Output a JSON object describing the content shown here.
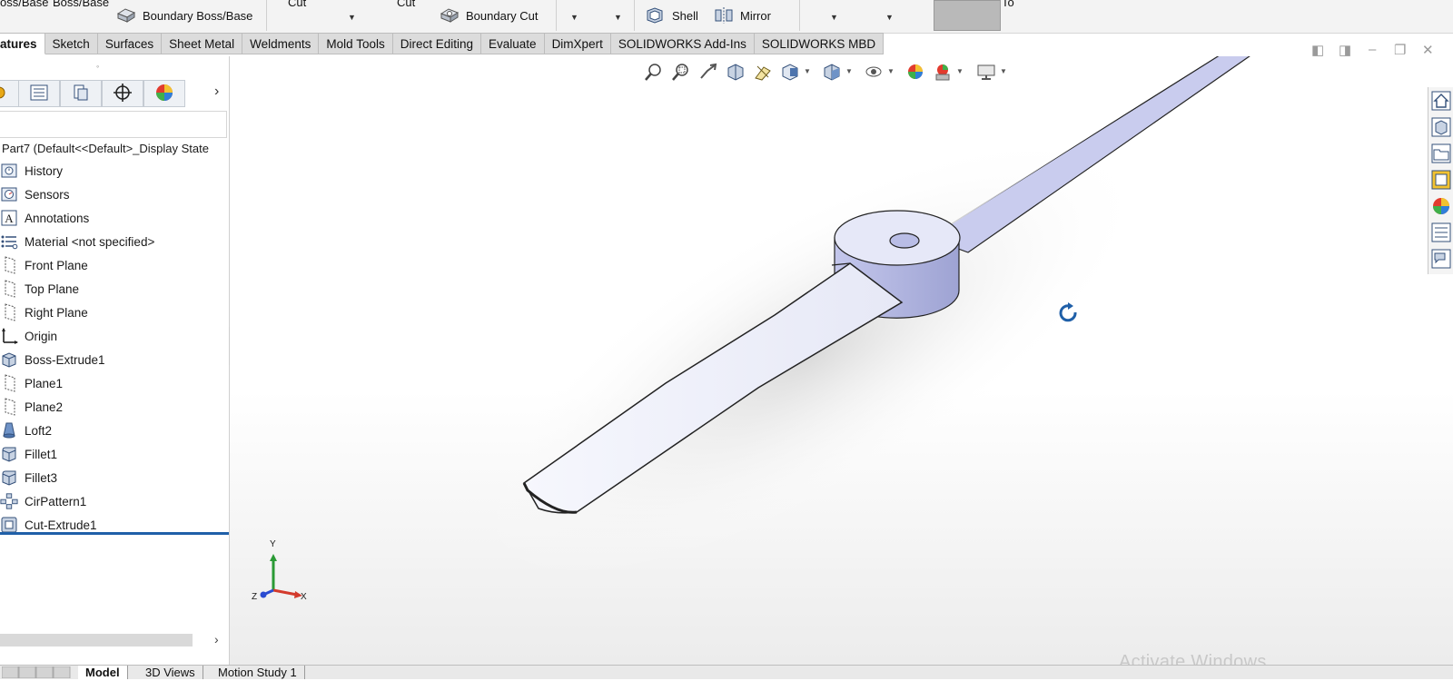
{
  "ribbon": {
    "boss_base_1": "oss/Base",
    "boss_base_2": "Boss/Base",
    "boundary_boss": "Boundary Boss/Base",
    "cut_1": "Cut",
    "cut_2": "Cut",
    "boundary_cut": "Boundary Cut",
    "shell": "Shell",
    "mirror": "Mirror",
    "to_partial": "To"
  },
  "tabs": [
    {
      "label": "atures",
      "active": true
    },
    {
      "label": "Sketch"
    },
    {
      "label": "Surfaces"
    },
    {
      "label": "Sheet Metal"
    },
    {
      "label": "Weldments"
    },
    {
      "label": "Mold Tools"
    },
    {
      "label": "Direct Editing"
    },
    {
      "label": "Evaluate"
    },
    {
      "label": "DimXpert"
    },
    {
      "label": "SOLIDWORKS Add-Ins"
    },
    {
      "label": "SOLIDWORKS MBD"
    }
  ],
  "feature_tree": {
    "root": "Part7  (Default<<Default>_Display State",
    "items": [
      {
        "label": "History",
        "icon": "history-icon"
      },
      {
        "label": "Sensors",
        "icon": "sensors-icon"
      },
      {
        "label": "Annotations",
        "icon": "annotations-icon"
      },
      {
        "label": "Material <not specified>",
        "icon": "material-icon"
      },
      {
        "label": "Front Plane",
        "icon": "plane-icon"
      },
      {
        "label": "Top Plane",
        "icon": "plane-icon"
      },
      {
        "label": "Right Plane",
        "icon": "plane-icon"
      },
      {
        "label": "Origin",
        "icon": "origin-icon"
      },
      {
        "label": "Boss-Extrude1",
        "icon": "boss-extrude-icon"
      },
      {
        "label": "Plane1",
        "icon": "plane-icon"
      },
      {
        "label": "Plane2",
        "icon": "plane-icon"
      },
      {
        "label": "Loft2",
        "icon": "loft-icon"
      },
      {
        "label": "Fillet1",
        "icon": "fillet-icon"
      },
      {
        "label": "Fillet3",
        "icon": "fillet-icon"
      },
      {
        "label": "CirPattern1",
        "icon": "circular-pattern-icon"
      },
      {
        "label": "Cut-Extrude1",
        "icon": "cut-extrude-icon"
      }
    ]
  },
  "triad": {
    "x": "X",
    "y": "Y",
    "z": "Z"
  },
  "bottom_tabs": [
    {
      "label": "Model",
      "active": true
    },
    {
      "label": "3D Views"
    },
    {
      "label": "Motion Study 1"
    }
  ],
  "watermark": "Activate Windows",
  "colors": {
    "part_face": "#c9ccee",
    "part_face_light": "#f4f5fc",
    "selection_line": "#1f5fa8",
    "tab_bg": "#dcdcdc"
  }
}
